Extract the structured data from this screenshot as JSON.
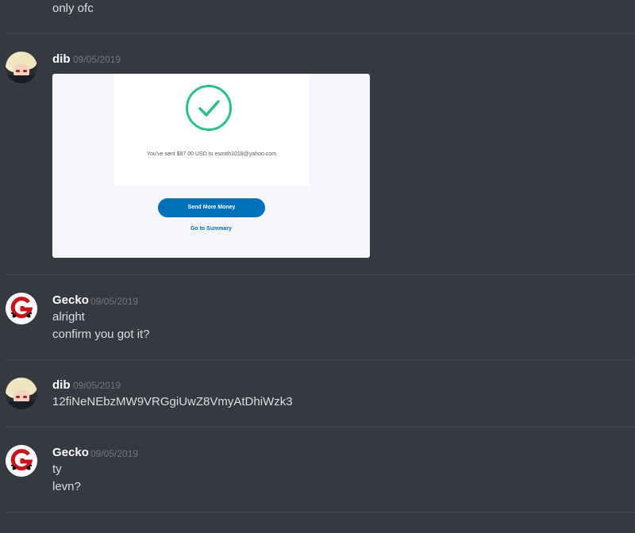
{
  "colors": {
    "background": "#36393f",
    "username": "#ffffff",
    "timestamp": "#72767d",
    "paypal_blue": "#0070ba",
    "check_green": "#2bbf8a"
  },
  "top_message": {
    "text": "only ofc"
  },
  "messages": [
    {
      "author": "dib",
      "timestamp": "09/05/2019",
      "embed": {
        "sent_text": "You've sent $87.00 USD to esmith1018@yahoo.com",
        "send_more_label": "Send More Money",
        "summary_link": "Go to Summary"
      }
    },
    {
      "author": "Gecko",
      "timestamp": "09/05/2019",
      "lines": [
        "alright",
        "confirm you got it?"
      ]
    },
    {
      "author": "dib",
      "timestamp": "09/05/2019",
      "lines": [
        "12fiNeNEbzMW9VRGgiUwZ8VmyAtDhiWzk3"
      ]
    },
    {
      "author": "Gecko",
      "timestamp": "09/05/2019",
      "lines": [
        "ty",
        "levn?"
      ]
    }
  ],
  "icons": {
    "dib_avatar": "anime-avatar",
    "gecko_avatar": "g-logo-avatar",
    "check": "checkmark-icon"
  }
}
